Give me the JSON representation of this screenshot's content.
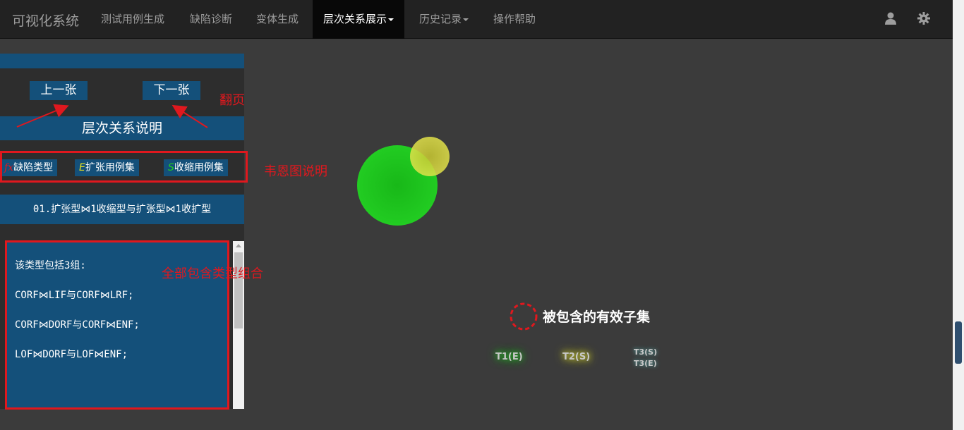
{
  "navbar": {
    "brand": "可视化系统",
    "items": [
      {
        "label": "测试用例生成"
      },
      {
        "label": "缺陷诊断"
      },
      {
        "label": "变体生成"
      },
      {
        "label": "层次关系展示",
        "active": true,
        "dropdown": true
      },
      {
        "label": "历史记录",
        "dropdown": true
      },
      {
        "label": "操作帮助"
      }
    ],
    "icons": [
      "user-icon",
      "gear-icon"
    ]
  },
  "panel": {
    "prev_button": "上一张",
    "next_button": "下一张",
    "section_title": "层次关系说明",
    "legend": [
      {
        "prefix": "fx",
        "label": "缺陷类型",
        "prefix_color": "#e0181e"
      },
      {
        "prefix": "E",
        "label": "扩张用例集",
        "prefix_color": "#e8e020"
      },
      {
        "prefix": "S",
        "label": "收缩用例集",
        "prefix_color": "#22cc22"
      }
    ],
    "type_title": "01.扩张型⋈1收缩型与扩张型⋈1收扩型",
    "description": {
      "intro": "该类型包括3组:",
      "lines": [
        "CORF⋈LIF与CORF⋈LRF;",
        "CORF⋈DORF与CORF⋈ENF;",
        "LOF⋈DORF与LOF⋈ENF;"
      ]
    }
  },
  "annotations": {
    "paging": "翻页",
    "venn_explain": "韦恩图说明",
    "all_contains": "全部包含类型组合"
  },
  "venn": {
    "legend_text": "被包含的有效子集",
    "labels": [
      "T1(E)",
      "T2(S)",
      "T3(S)",
      "T3(E)"
    ],
    "colors": {
      "green": "#1fc21f",
      "yellow": "#d9d92a",
      "dash": "#e0181e"
    }
  }
}
